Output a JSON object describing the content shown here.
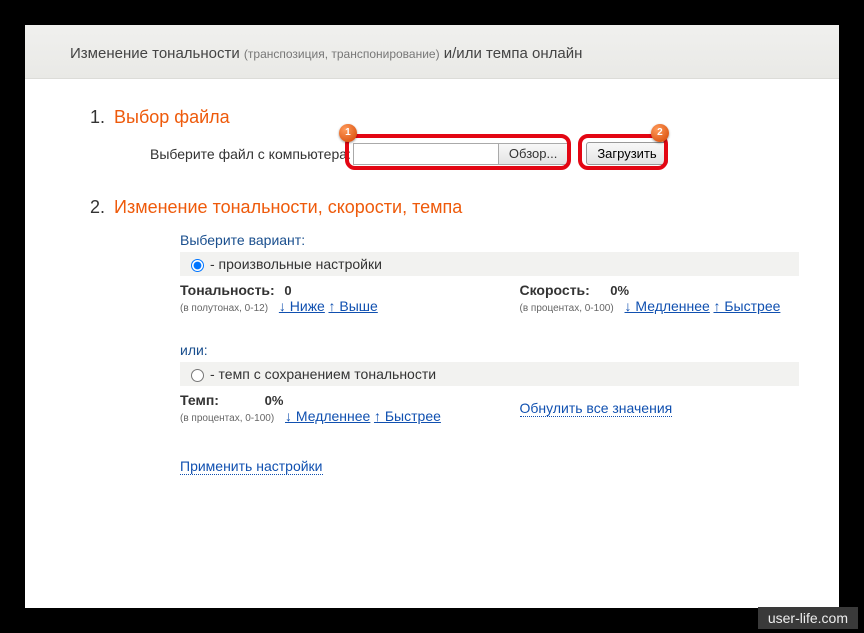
{
  "header": {
    "main_before": "Изменение тональности",
    "main_paren": "(транспозиция, транспонирование)",
    "main_after": "и/или темпа онлайн"
  },
  "section1": {
    "num": "1.",
    "title": "Выбор файла",
    "label": "Выберите файл с компьютера:",
    "browse": "Обзор...",
    "upload": "Загрузить",
    "badge1": "1",
    "badge2": "2"
  },
  "section2": {
    "num": "2.",
    "title": "Изменение тональности, скорости, темпа",
    "variant_label": "Выберите вариант:",
    "opt_custom": "- произвольные настройки",
    "opt_tempo": "- темп с сохранением тональности",
    "or_label": "или:",
    "pitch": {
      "label": "Тональность:",
      "value": "0",
      "note": "(в полутонах, 0-12)",
      "lower": "↓ Ниже",
      "higher": "↑ Выше"
    },
    "speed": {
      "label": "Скорость:",
      "value": "0%",
      "note": "(в процентах, 0-100)",
      "slower": "↓ Медленнее",
      "faster": "↑ Быстрее"
    },
    "tempo": {
      "label": "Темп:",
      "value": "0%",
      "note": "(в процентах, 0-100)",
      "slower": "↓ Медленнее",
      "faster": "↑ Быстрее"
    },
    "reset": "Обнулить все значения",
    "apply": "Применить настройки"
  },
  "watermark": "user-life.com"
}
